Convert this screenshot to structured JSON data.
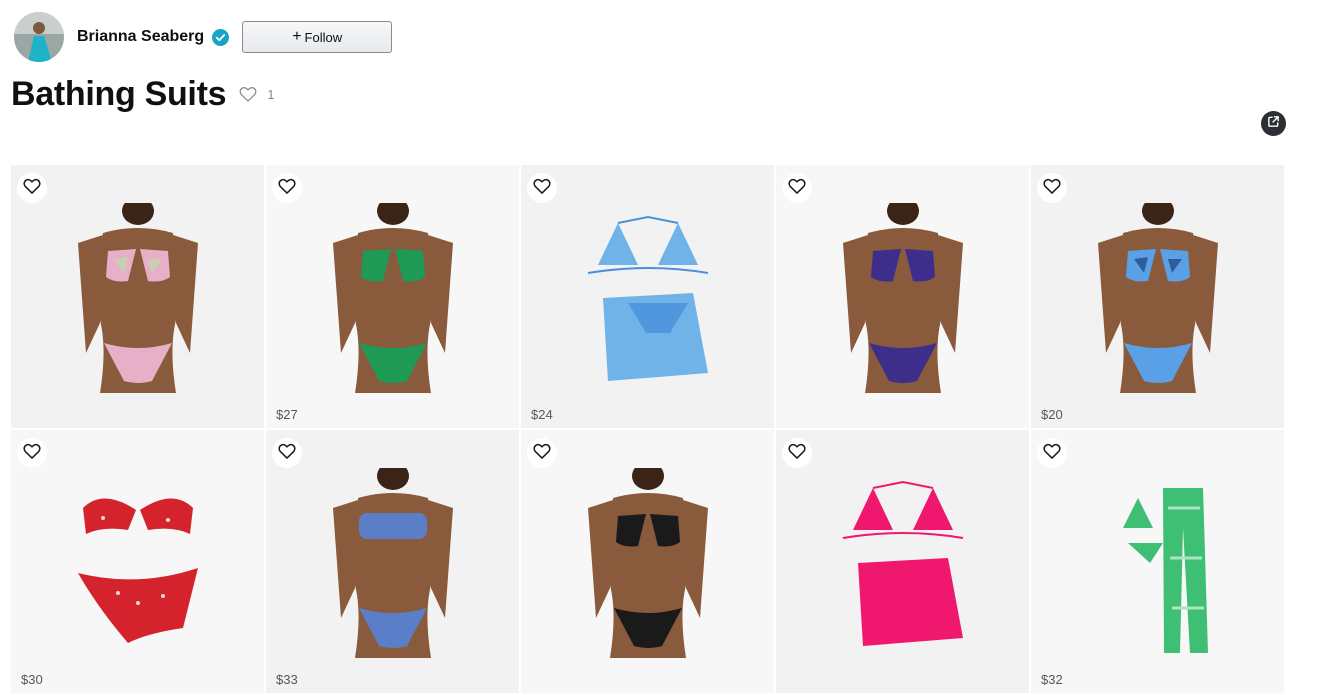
{
  "creator": {
    "name": "Brianna Seaberg",
    "verified_icon": "verified-check-icon",
    "verified_color": "#1aa3c5",
    "follow_label": "Follow"
  },
  "list": {
    "title": "Bathing Suits",
    "like_count": "1"
  },
  "products": [
    {
      "price": "",
      "color": "#e8b0c8",
      "accent": "#b8e0a8",
      "style": "triangle-tie"
    },
    {
      "price": "$27",
      "color": "#1e9a55",
      "accent": "#1e9a55",
      "style": "underwire"
    },
    {
      "price": "$24",
      "color": "#6fb3e8",
      "accent": "#4a90d9",
      "style": "three-piece"
    },
    {
      "price": "",
      "color": "#3d2e8c",
      "accent": "#3d2e8c",
      "style": "triangle"
    },
    {
      "price": "$20",
      "color": "#5aa0e6",
      "accent": "#1f3f7a",
      "style": "triangle-tie"
    },
    {
      "price": "$30",
      "color": "#d4232c",
      "accent": "#f5d6d6",
      "style": "underwire"
    },
    {
      "price": "$33",
      "color": "#5a7ec8",
      "accent": "#5a7ec8",
      "style": "bandeau"
    },
    {
      "price": "",
      "color": "#1a1a1a",
      "accent": "#1a1a1a",
      "style": "triangle-tie"
    },
    {
      "price": "",
      "color": "#f0186e",
      "accent": "#f0186e",
      "style": "three-piece"
    },
    {
      "price": "$32",
      "color": "#3fbf73",
      "accent": "#a8e6c0",
      "style": "pants-set"
    }
  ]
}
